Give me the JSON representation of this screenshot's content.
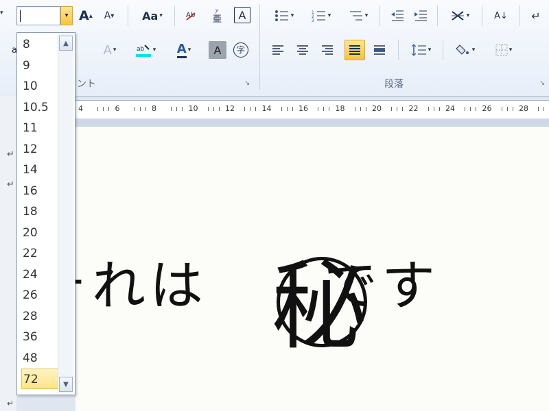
{
  "font_size_combo": {
    "value": "",
    "dropdown_arrow": "▾"
  },
  "font_size_options": [
    "8",
    "9",
    "10",
    "10.5",
    "11",
    "12",
    "14",
    "16",
    "18",
    "20",
    "22",
    "24",
    "26",
    "28",
    "36",
    "48",
    "72"
  ],
  "highlighted_option": "72",
  "ribbon": {
    "group_font_label": "ント",
    "group_paragraph_label": "段落",
    "grow_font": "A",
    "shrink_font": "A",
    "change_case": "Aa",
    "phonetic_guide": "ア",
    "char_border": "A",
    "font_color": "A",
    "char_shading": "A",
    "enclose_char": "字",
    "left_edge_label": "a",
    "sort": "A↓",
    "show_marks": "↵"
  },
  "ruler_labels": [
    "4",
    "6",
    "8",
    "10",
    "12",
    "14",
    "16",
    "18",
    "20",
    "22",
    "24",
    "26",
    "28"
  ],
  "document": {
    "text_before": "それは",
    "secret_char": "秘",
    "text_after": "です"
  },
  "colors": {
    "accent_orange": "#f8c43b",
    "highlight_cyan": "#00e0ff",
    "ribbon_blue": "#1e2f4e"
  }
}
